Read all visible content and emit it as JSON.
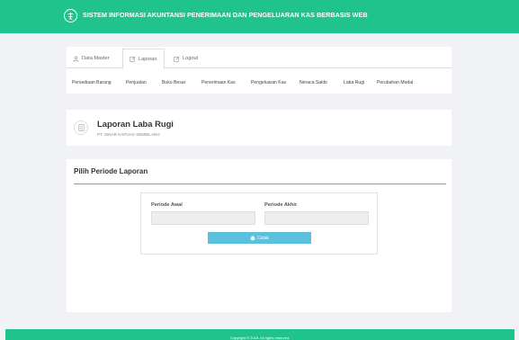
{
  "header": {
    "title": "SISTEM INFORMASI AKUNTANSI PENERIMAAN DAN PENGELUARAN KAS BERBASIS WEB"
  },
  "nav": {
    "tabs": [
      {
        "label": "Data Master",
        "icon": "user-icon",
        "active": false
      },
      {
        "label": "Laporan",
        "icon": "edit-icon",
        "active": true
      },
      {
        "label": "Logout",
        "icon": "edit-icon",
        "active": false
      }
    ],
    "sublinks": [
      "Persediaan Barang",
      "Penjualan",
      "Buku Besar",
      "Penerimaan Kas",
      "Pengeluaran Kas",
      "Neraca Saldo",
      "Laba Rugi",
      "Perubahan Modal"
    ]
  },
  "report": {
    "icon": "document-icon",
    "title": "Laporan Laba Rugi",
    "company": "PT. SINAR KAPUAS SEMBILANG"
  },
  "form": {
    "section_title": "Pilih Periode Laporan",
    "start_label": "Periode Awal",
    "start_value": "",
    "end_label": "Periode Akhir",
    "end_value": "",
    "print_label": "Cetak",
    "print_icon": "print-icon"
  },
  "footer": {
    "copyright": "Copyright © 2018. All rights reserved."
  },
  "colors": {
    "brand": "#20c38c",
    "button": "#5bc0de",
    "background": "#f0f2f5"
  }
}
